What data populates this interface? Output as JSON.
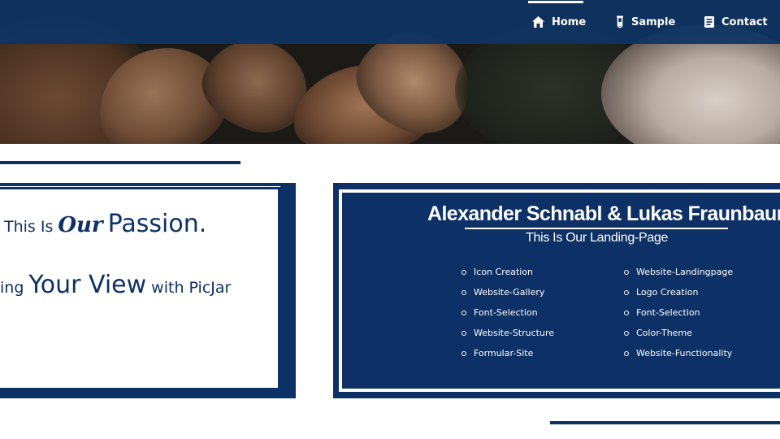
{
  "nav": {
    "items": [
      {
        "label": "Home",
        "icon": "home-icon",
        "active": true
      },
      {
        "label": "Sample",
        "icon": "test-tube-icon",
        "active": false
      },
      {
        "label": "Contact",
        "icon": "contact-card-icon",
        "active": false
      }
    ]
  },
  "hero": {
    "image": "dried-leaves-photo"
  },
  "left_card": {
    "line1": {
      "pre": "This Is",
      "script": "Our",
      "post": "Passion."
    },
    "line2": {
      "pre": "ing",
      "big": "Your View",
      "post": "with PicJar"
    }
  },
  "right_card": {
    "title": "Alexander Schnabl & Lukas Fraunbaum",
    "subtitle": "This Is Our Landing-Page",
    "features_left": [
      "Icon Creation",
      "Website-Gallery",
      "Font-Selection",
      "Website-Structure",
      "Formular-Site"
    ],
    "features_right": [
      "Website-Landingpage",
      "Logo Creation",
      "Font-Selection",
      "Color-Theme",
      "Website-Functionality"
    ]
  },
  "colors": {
    "navy": "#0d3166",
    "navbar": "#0e3464",
    "white": "#ffffff"
  }
}
